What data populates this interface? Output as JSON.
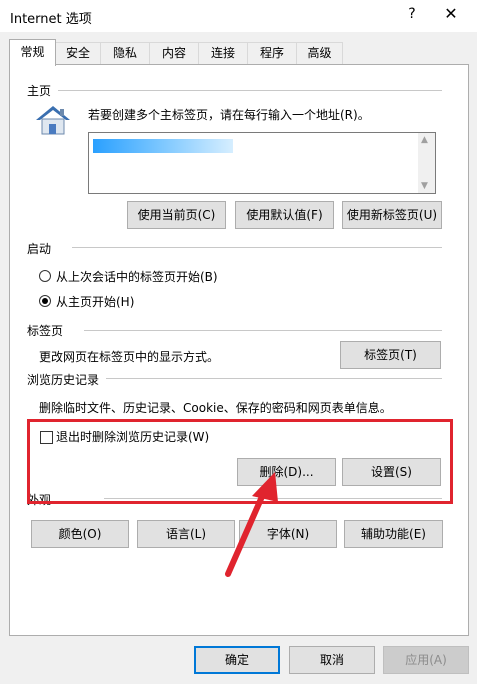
{
  "window": {
    "title": "Internet 选项",
    "help": "?",
    "close": "✕"
  },
  "tabs": [
    "常规",
    "安全",
    "隐私",
    "内容",
    "连接",
    "程序",
    "高级"
  ],
  "home": {
    "section": "主页",
    "instruction": "若要创建多个主标签页，请在每行输入一个地址(R)。",
    "buttons": [
      "使用当前页(C)",
      "使用默认值(F)",
      "使用新标签页(U)"
    ]
  },
  "startup": {
    "section": "启动",
    "options": [
      "从上次会话中的标签页开始(B)",
      "从主页开始(H)"
    ],
    "selected_index": 1
  },
  "tabs_section": {
    "section": "标签页",
    "description": "更改网页在标签页中的显示方式。",
    "button": "标签页(T)"
  },
  "history": {
    "section": "浏览历史记录",
    "description": "删除临时文件、历史记录、Cookie、保存的密码和网页表单信息。",
    "checkbox": "退出时删除浏览历史记录(W)",
    "checked": false,
    "delete_button": "删除(D)...",
    "settings_button": "设置(S)"
  },
  "appearance": {
    "section": "外观",
    "buttons": [
      "颜色(O)",
      "语言(L)",
      "字体(N)",
      "辅助功能(E)"
    ]
  },
  "footer": {
    "ok": "确定",
    "cancel": "取消",
    "apply": "应用(A)"
  },
  "colors": {
    "highlight_red": "#e0242e",
    "accent": "#0078d7"
  }
}
